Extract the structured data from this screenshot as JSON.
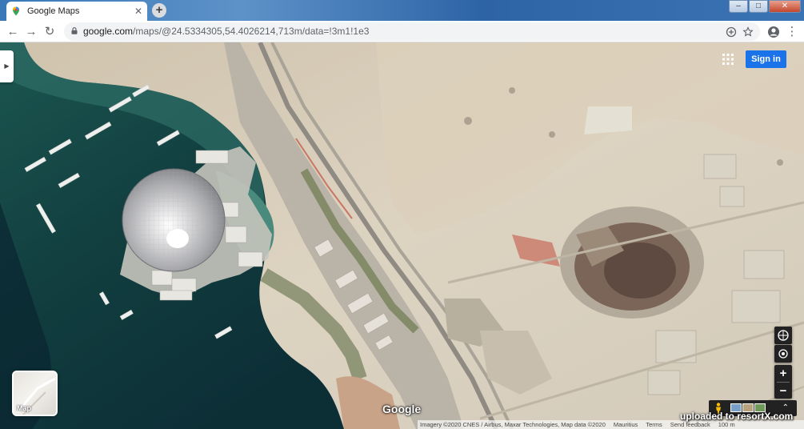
{
  "browser": {
    "tab_title": "Google Maps",
    "tab_close": "✕",
    "new_tab": "+",
    "url_domain": "google.com",
    "url_path": "/maps/@24.5334305,54.4026214,713m/data=!3m1!1e3",
    "win_min": "–",
    "win_max": "□",
    "win_close": "✕"
  },
  "nav": {
    "back": "←",
    "forward": "→",
    "reload": "↻",
    "kebab": "⋮"
  },
  "map": {
    "collapse_label": "▶",
    "signin_label": "Sign in",
    "layer_label": "Map",
    "logo_text": "Google",
    "zoom_in": "+",
    "zoom_out": "−",
    "chevron": "⌃",
    "footer": {
      "imagery": "Imagery ©2020 CNES / Airbus, Maxar Technologies, Map data ©2020",
      "country": "Mauritius",
      "terms": "Terms",
      "feedback": "Send feedback",
      "scale": "100 m"
    },
    "watermark": "uploaded to resortX.com"
  },
  "colors": {
    "sea_dark": "#0f3b3c",
    "sea_light": "#2d6b63",
    "sand": "#d8ccb8",
    "signin_blue": "#1a73e8"
  },
  "icons": [
    "google-maps-favicon",
    "lock-icon",
    "apps-grid-icon",
    "compass-icon",
    "location-icon",
    "pegman-icon"
  ]
}
